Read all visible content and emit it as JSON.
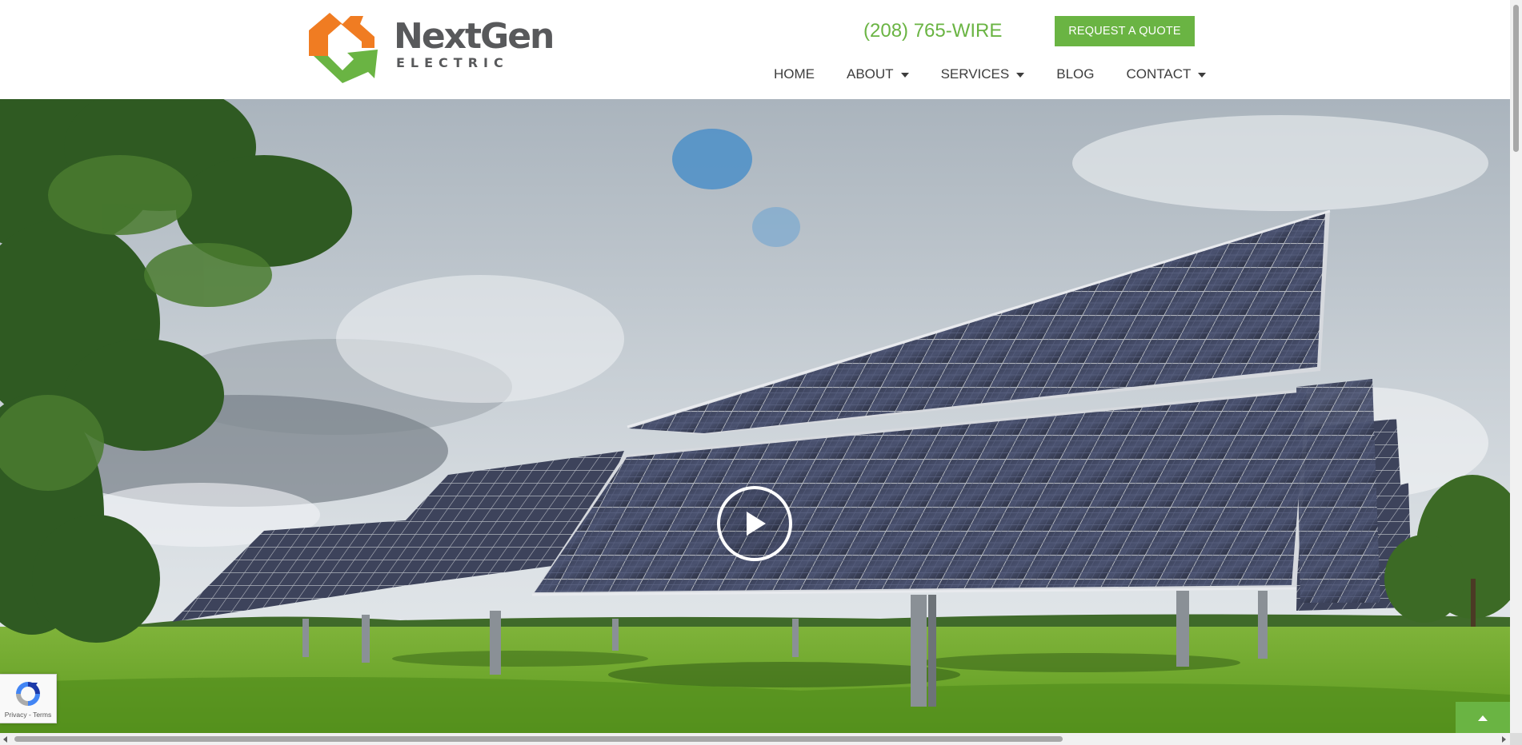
{
  "brand": {
    "name": "NextGen",
    "tagline": "ELECTRIC",
    "logo_icon": "house-arrows-logo"
  },
  "header": {
    "phone": "(208) 765-WIRE",
    "quote_button": "REQUEST A QUOTE"
  },
  "nav": {
    "items": [
      {
        "label": "HOME",
        "dropdown": false
      },
      {
        "label": "ABOUT",
        "dropdown": true
      },
      {
        "label": "SERVICES",
        "dropdown": true
      },
      {
        "label": "BLOG",
        "dropdown": false
      },
      {
        "label": "CONTACT",
        "dropdown": true
      }
    ]
  },
  "hero": {
    "image_icon": "solar-panel-field-image",
    "play_icon": "play-circle-icon"
  },
  "recaptcha": {
    "privacy": "Privacy",
    "separator": "-",
    "terms": "Terms"
  },
  "colors": {
    "brand_green": "#6ab443",
    "brand_orange": "#f07c22",
    "text_gray": "#58595b"
  }
}
